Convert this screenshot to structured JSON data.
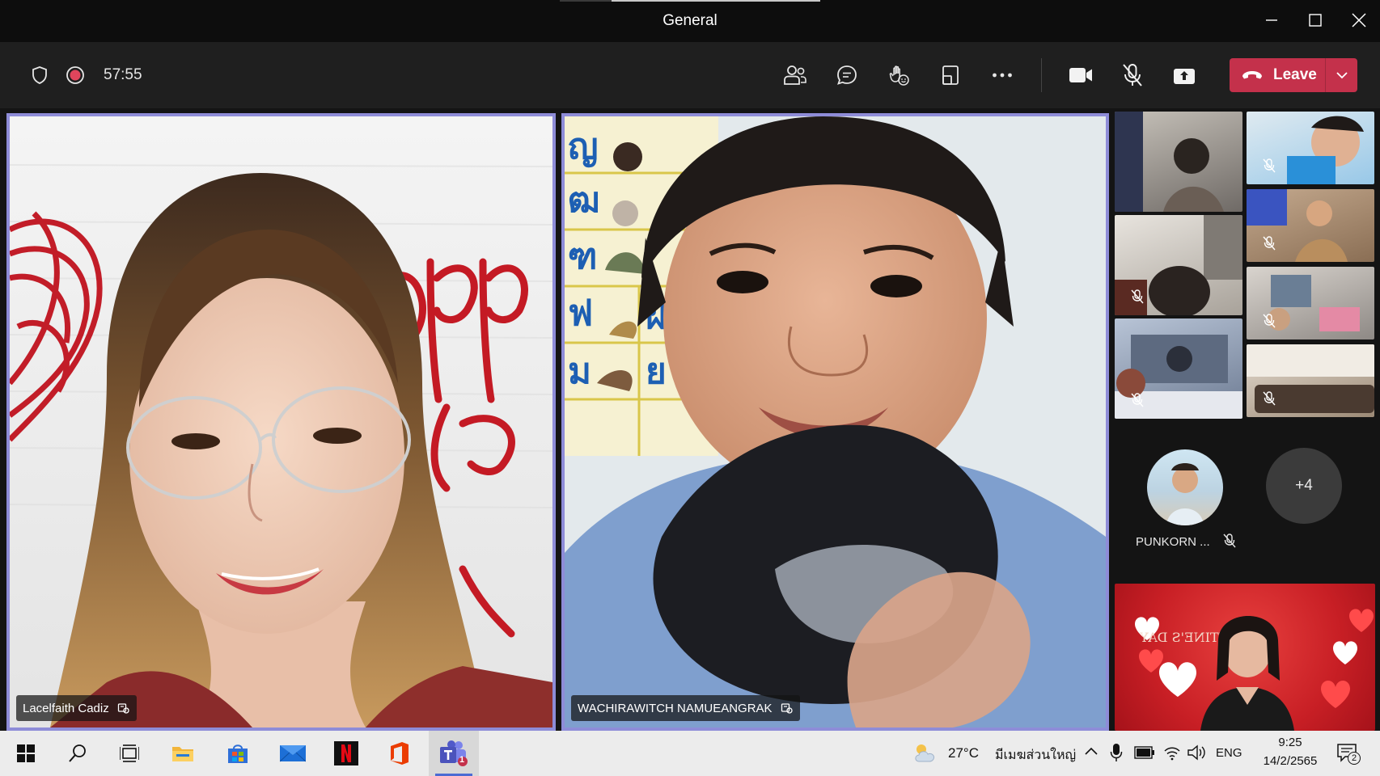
{
  "window": {
    "title": "General",
    "controls": [
      "minimize",
      "maximize",
      "close"
    ]
  },
  "toolbar": {
    "timer": "57:55",
    "leave_label": "Leave",
    "icons": [
      "shield-icon",
      "record-icon",
      "people-icon",
      "chat-icon",
      "raise-hand-icon",
      "share-screen-icon",
      "more-options-icon",
      "camera-icon",
      "mic-muted-icon",
      "share-tray-icon"
    ]
  },
  "participants": {
    "main": [
      {
        "name": "Lacelfaith Cadiz"
      },
      {
        "name": "WACHIRAWITCH NAMUEANGRAK"
      }
    ],
    "avatar_name": "PUNKORN ...",
    "overflow_count": "+4"
  },
  "taskbar": {
    "weather_temp": "27°C",
    "weather_location": "มีเมฆส่วนใหญ่",
    "language": "ENG",
    "time": "9:25",
    "date": "14/2/2565",
    "teams_badge": "1",
    "notification_count": "2"
  },
  "colors": {
    "accent_border": "#8e8cd8",
    "leave_red": "#c4314b",
    "toolbar_bg": "#1f1f1f",
    "record_red": "#e0455c"
  }
}
